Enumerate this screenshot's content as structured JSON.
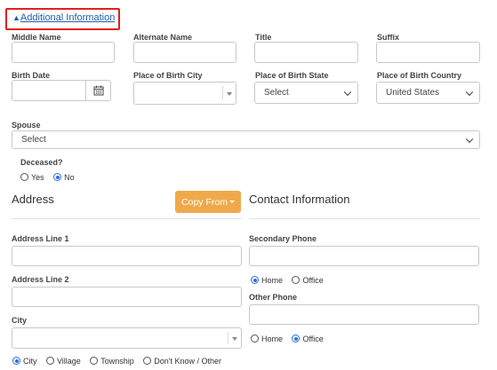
{
  "toggle": {
    "arrow": "▲",
    "label": "Additional Information"
  },
  "fields": {
    "middle_name": "Middle Name",
    "alternate_name": "Alternate Name",
    "title": "Title",
    "suffix": "Suffix",
    "birth_date": "Birth Date",
    "place_of_birth_city": "Place of Birth City",
    "place_of_birth_state": "Place of Birth State",
    "place_of_birth_state_value": "Select",
    "place_of_birth_country": "Place of Birth Country",
    "place_of_birth_country_value": "United States",
    "spouse": "Spouse",
    "spouse_value": "Select",
    "deceased": "Deceased?",
    "deceased_options": [
      "Yes",
      "No"
    ]
  },
  "address": {
    "heading": "Address",
    "copy_from": "Copy From",
    "line1": "Address Line 1",
    "line2": "Address Line 2",
    "city": "City",
    "city_type_options": [
      "City",
      "Village",
      "Township",
      "Don't Know / Other"
    ]
  },
  "contact": {
    "heading": "Contact Information",
    "secondary_phone": "Secondary Phone",
    "secondary_phone_options": [
      "Home",
      "Office"
    ],
    "other_phone": "Other Phone",
    "other_phone_options": [
      "Home",
      "Office"
    ]
  },
  "icons": {
    "calendar": "calendar-icon",
    "dropdown": "chevron-down-icon",
    "caret": "caret-down-icon"
  },
  "colors": {
    "link": "#1f5fa8",
    "highlight": "#e0211b",
    "copy_button": "#f0a94a",
    "radio_selected": "#2a6fd6"
  }
}
